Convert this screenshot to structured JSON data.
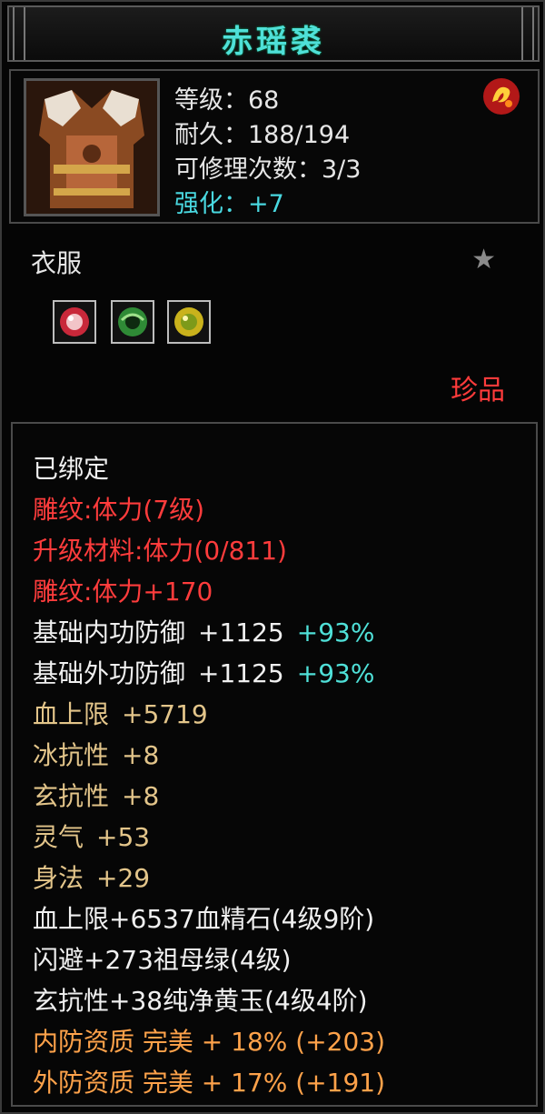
{
  "title": "赤瑶裘",
  "stats": {
    "level": "等级：68",
    "durability": "耐久：188/194",
    "repairs": "可修理次数：3/3",
    "enhance": "强化：+7"
  },
  "category": "衣服",
  "rarity": "珍品",
  "attributes": {
    "bound": "已绑定",
    "engrave": "雕纹:体力(7级)",
    "upgrade_mat": "升级材料:体力(0/811)",
    "engrave_bonus": "雕纹:体力+170",
    "inner_def_label": "基础内功防御",
    "inner_def_val": "+1125",
    "inner_def_pct": "+93%",
    "outer_def_label": "基础外功防御",
    "outer_def_val": "+1125",
    "outer_def_pct": "+93%",
    "hp_label": "血上限",
    "hp_val": "+5719",
    "ice_label": "冰抗性",
    "ice_val": "+8",
    "mystic_label": "玄抗性",
    "mystic_val": "+8",
    "spirit_label": "灵气",
    "spirit_val": "+53",
    "agility_label": "身法",
    "agility_val": "+29",
    "gem1": "血上限+6537血精石(4级9阶)",
    "gem2": "闪避+273祖母绿(4级)",
    "gem3": "玄抗性+38纯净黄玉(4级4阶)",
    "quality1": "内防资质 完美 + 18% (+203)",
    "quality2": "外防资质 完美 + 17% (+191)"
  },
  "colors": {
    "title": "#4fe0d8",
    "red": "#ff3c3c",
    "gold": "#e3c58a",
    "orange": "#ffa24a",
    "cyan": "#4fe0d8"
  }
}
